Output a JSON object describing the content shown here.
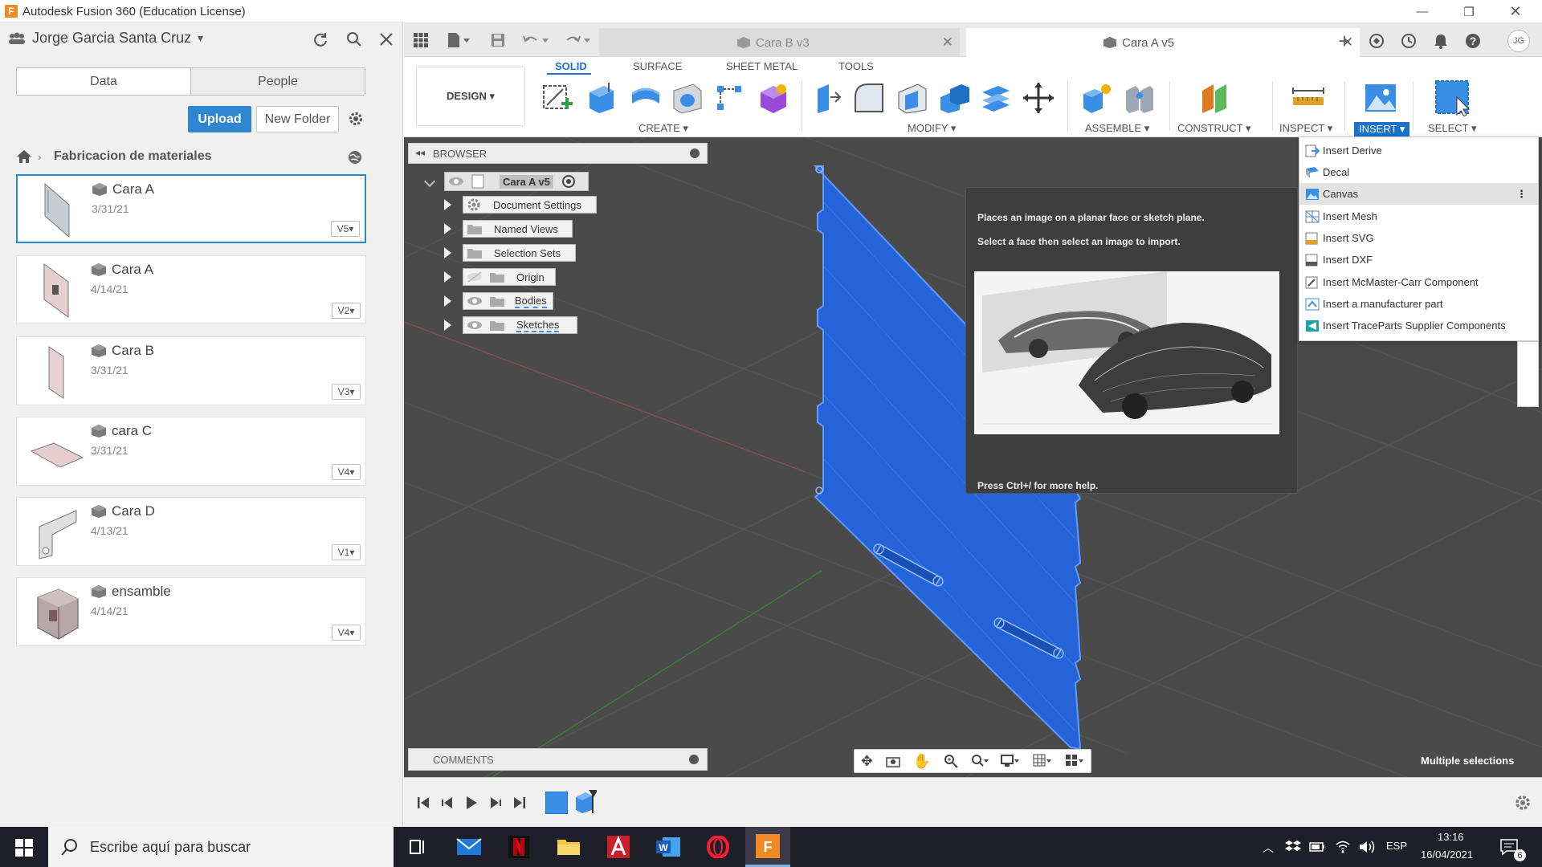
{
  "window": {
    "title": "Autodesk Fusion 360 (Education License)",
    "app_icon_letter": "F"
  },
  "data_panel": {
    "user_name": "Jorge Garcia Santa Cruz",
    "tabs": [
      {
        "label": "Data"
      },
      {
        "label": "People"
      }
    ],
    "upload_label": "Upload",
    "new_folder_label": "New Folder",
    "breadcrumb": "Fabricacion de materiales",
    "files": [
      {
        "name": "Cara A",
        "date": "3/31/21",
        "version": "V5▾",
        "selected": true
      },
      {
        "name": "Cara A",
        "date": "4/14/21",
        "version": "V2▾",
        "selected": false
      },
      {
        "name": "Cara B",
        "date": "3/31/21",
        "version": "V3▾",
        "selected": false
      },
      {
        "name": "cara C",
        "date": "3/31/21",
        "version": "V4▾",
        "selected": false
      },
      {
        "name": "Cara D",
        "date": "4/13/21",
        "version": "V1▾",
        "selected": false
      },
      {
        "name": "ensamble",
        "date": "4/14/21",
        "version": "V4▾",
        "selected": false
      }
    ]
  },
  "doc_tabs": [
    {
      "label": "Cara B v3",
      "active": false
    },
    {
      "label": "Cara A v5",
      "active": true
    }
  ],
  "toolbar": {
    "user_initials": "JG",
    "workspace": "DESIGN ▾",
    "tabs": [
      {
        "label": "SOLID",
        "active": true
      },
      {
        "label": "SURFACE",
        "active": false
      },
      {
        "label": "SHEET METAL",
        "active": false
      },
      {
        "label": "TOOLS",
        "active": false
      }
    ],
    "groups": [
      {
        "label": "CREATE ▾"
      },
      {
        "label": "MODIFY ▾"
      },
      {
        "label": "ASSEMBLE ▾"
      },
      {
        "label": "CONSTRUCT ▾"
      },
      {
        "label": "INSPECT ▾"
      },
      {
        "label": "INSERT ▾"
      },
      {
        "label": "SELECT ▾"
      }
    ]
  },
  "browser": {
    "title": "BROWSER",
    "root": "Cara A v5",
    "items": [
      {
        "label": "Document Settings"
      },
      {
        "label": "Named Views"
      },
      {
        "label": "Selection Sets"
      },
      {
        "label": "Origin"
      },
      {
        "label": "Bodies"
      },
      {
        "label": "Sketches"
      }
    ]
  },
  "comments": {
    "title": "COMMENTS"
  },
  "tooltip": {
    "line1": "Places an image on a planar face or sketch plane.",
    "line2": "Select a face then select an image to import.",
    "footer": "Press Ctrl+/ for more help."
  },
  "insert_menu": {
    "items": [
      {
        "label": "Insert Derive",
        "icon": "derive-icon",
        "highlight": false
      },
      {
        "label": "Decal",
        "icon": "decal-icon",
        "highlight": false
      },
      {
        "label": "Canvas",
        "icon": "canvas-icon",
        "highlight": true
      },
      {
        "label": "Insert Mesh",
        "icon": "mesh-icon",
        "highlight": false
      },
      {
        "label": "Insert SVG",
        "icon": "svg-icon",
        "highlight": false
      },
      {
        "label": "Insert DXF",
        "icon": "dxf-icon",
        "highlight": false
      },
      {
        "label": "Insert McMaster-Carr Component",
        "icon": "mcmaster-icon",
        "highlight": false
      },
      {
        "label": "Insert a manufacturer part",
        "icon": "manufacturer-icon",
        "highlight": false
      },
      {
        "label": "Insert TraceParts Supplier Components",
        "icon": "traceparts-icon",
        "highlight": false
      }
    ]
  },
  "status": {
    "selection_text": "Multiple selections"
  },
  "taskbar": {
    "search_placeholder": "Escribe aquí para buscar",
    "language": "ESP",
    "time": "13:16",
    "date": "16/04/2021",
    "notification_count": "6"
  },
  "colors": {
    "accent": "#1a73c8",
    "body_blue": "#2563d8",
    "viewport_bg": "#4a4a4a",
    "taskbar_bg": "#1f1f2a"
  }
}
